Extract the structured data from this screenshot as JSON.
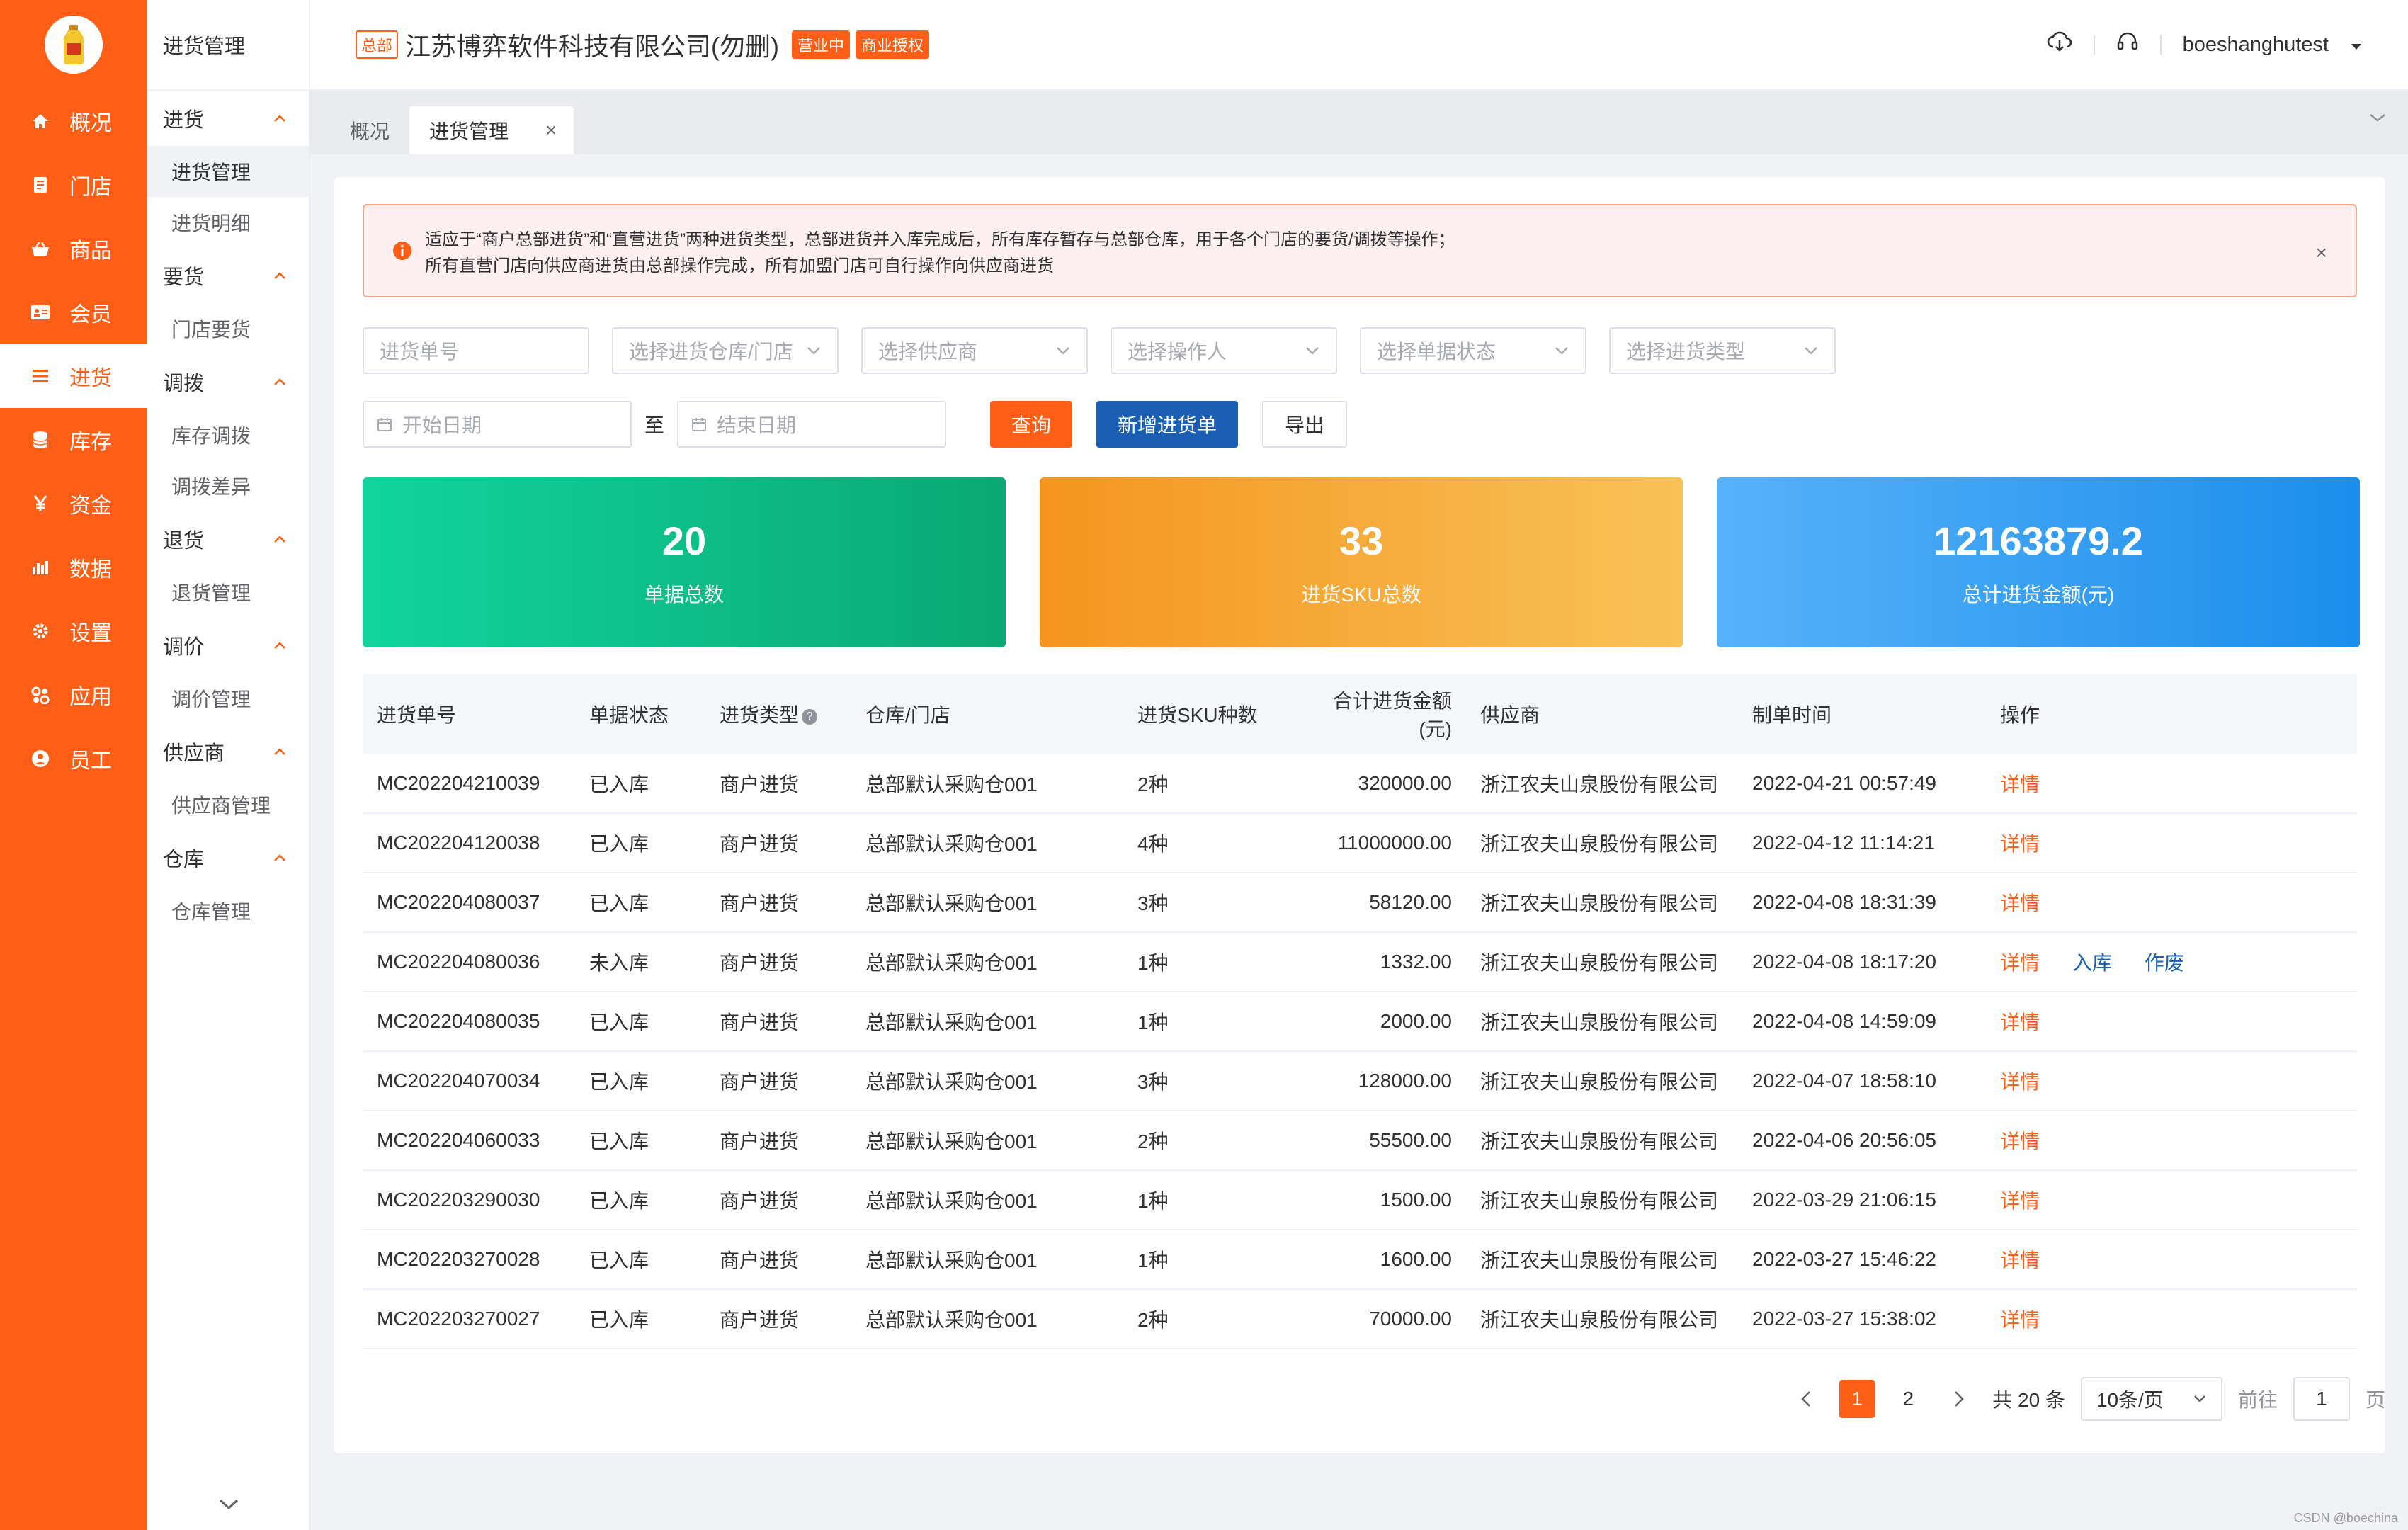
{
  "nav": [
    {
      "label": "概况",
      "icon": "home-icon"
    },
    {
      "label": "门店",
      "icon": "store-icon"
    },
    {
      "label": "商品",
      "icon": "goods-icon"
    },
    {
      "label": "会员",
      "icon": "member-card-icon"
    },
    {
      "label": "进货",
      "icon": "list-icon",
      "active": true
    },
    {
      "label": "库存",
      "icon": "database-icon"
    },
    {
      "label": "资金",
      "icon": "yen-icon"
    },
    {
      "label": "数据",
      "icon": "bar-chart-icon"
    },
    {
      "label": "设置",
      "icon": "gear-icon"
    },
    {
      "label": "应用",
      "icon": "apps-icon"
    },
    {
      "label": "员工",
      "icon": "user-icon"
    }
  ],
  "subnav": {
    "title": "进货管理",
    "groups": [
      {
        "label": "进货",
        "items": [
          "进货管理",
          "进货明细"
        ]
      },
      {
        "label": "要货",
        "items": [
          "门店要货"
        ]
      },
      {
        "label": "调拨",
        "items": [
          "库存调拨",
          "调拨差异"
        ]
      },
      {
        "label": "退货",
        "items": [
          "退货管理"
        ]
      },
      {
        "label": "调价",
        "items": [
          "调价管理"
        ]
      },
      {
        "label": "供应商",
        "items": [
          "供应商管理"
        ]
      },
      {
        "label": "仓库",
        "items": [
          "仓库管理"
        ]
      }
    ]
  },
  "header": {
    "hq_tag": "总部",
    "company": "江苏博弈软件科技有限公司(勿删)",
    "status_tag": "营业中",
    "license_tag": "商业授权",
    "username": "boeshanghutest"
  },
  "tabs": {
    "overview": "概况",
    "current": "进货管理",
    "close": "×"
  },
  "alert": {
    "line1": "适应于“商户总部进货”和“直营进货”两种进货类型，总部进货并入库完成后，所有库存暂存与总部仓库，用于各个门店的要货/调拨等操作；",
    "line2": "所有直营门店向供应商进货由总部操作完成，所有加盟门店可自行操作向供应商进货",
    "close": "×"
  },
  "filters": {
    "order_no": "进货单号",
    "warehouse": "选择进货仓库/门店",
    "supplier": "选择供应商",
    "operator": "选择操作人",
    "status": "选择单据状态",
    "type": "选择进货类型",
    "start_date": "开始日期",
    "to": "至",
    "end_date": "结束日期"
  },
  "buttons": {
    "query": "查询",
    "new_order": "新增进货单",
    "export": "导出"
  },
  "stats": [
    {
      "value": "20",
      "label": "单据总数"
    },
    {
      "value": "33",
      "label": "进货SKU总数"
    },
    {
      "value": "12163879.2",
      "label": "总计进货金额(元)"
    }
  ],
  "table": {
    "columns": [
      "进货单号",
      "单据状态",
      "进货类型",
      "仓库/门店",
      "进货SKU种数",
      "合计进货金额(元)",
      "供应商",
      "制单时间",
      "操作"
    ],
    "rows": [
      {
        "no": "MC202204210039",
        "status": "已入库",
        "type": "商户进货",
        "warehouse": "总部默认采购仓001",
        "sku": "2种",
        "amount": "320000.00",
        "supplier": "浙江农夫山泉股份有限公司",
        "time": "2022-04-21 00:57:49",
        "ops": [
          "详情"
        ]
      },
      {
        "no": "MC202204120038",
        "status": "已入库",
        "type": "商户进货",
        "warehouse": "总部默认采购仓001",
        "sku": "4种",
        "amount": "11000000.00",
        "supplier": "浙江农夫山泉股份有限公司",
        "time": "2022-04-12 11:14:21",
        "ops": [
          "详情"
        ]
      },
      {
        "no": "MC202204080037",
        "status": "已入库",
        "type": "商户进货",
        "warehouse": "总部默认采购仓001",
        "sku": "3种",
        "amount": "58120.00",
        "supplier": "浙江农夫山泉股份有限公司",
        "time": "2022-04-08 18:31:39",
        "ops": [
          "详情"
        ]
      },
      {
        "no": "MC202204080036",
        "status": "未入库",
        "type": "商户进货",
        "warehouse": "总部默认采购仓001",
        "sku": "1种",
        "amount": "1332.00",
        "supplier": "浙江农夫山泉股份有限公司",
        "time": "2022-04-08 18:17:20",
        "ops": [
          "详情",
          "入库",
          "作废"
        ]
      },
      {
        "no": "MC202204080035",
        "status": "已入库",
        "type": "商户进货",
        "warehouse": "总部默认采购仓001",
        "sku": "1种",
        "amount": "2000.00",
        "supplier": "浙江农夫山泉股份有限公司",
        "time": "2022-04-08 14:59:09",
        "ops": [
          "详情"
        ]
      },
      {
        "no": "MC202204070034",
        "status": "已入库",
        "type": "商户进货",
        "warehouse": "总部默认采购仓001",
        "sku": "3种",
        "amount": "128000.00",
        "supplier": "浙江农夫山泉股份有限公司",
        "time": "2022-04-07 18:58:10",
        "ops": [
          "详情"
        ]
      },
      {
        "no": "MC202204060033",
        "status": "已入库",
        "type": "商户进货",
        "warehouse": "总部默认采购仓001",
        "sku": "2种",
        "amount": "55500.00",
        "supplier": "浙江农夫山泉股份有限公司",
        "time": "2022-04-06 20:56:05",
        "ops": [
          "详情"
        ]
      },
      {
        "no": "MC202203290030",
        "status": "已入库",
        "type": "商户进货",
        "warehouse": "总部默认采购仓001",
        "sku": "1种",
        "amount": "1500.00",
        "supplier": "浙江农夫山泉股份有限公司",
        "time": "2022-03-29 21:06:15",
        "ops": [
          "详情"
        ]
      },
      {
        "no": "MC202203270028",
        "status": "已入库",
        "type": "商户进货",
        "warehouse": "总部默认采购仓001",
        "sku": "1种",
        "amount": "1600.00",
        "supplier": "浙江农夫山泉股份有限公司",
        "time": "2022-03-27 15:46:22",
        "ops": [
          "详情"
        ]
      },
      {
        "no": "MC202203270027",
        "status": "已入库",
        "type": "商户进货",
        "warehouse": "总部默认采购仓001",
        "sku": "2种",
        "amount": "70000.00",
        "supplier": "浙江农夫山泉股份有限公司",
        "time": "2022-03-27 15:38:02",
        "ops": [
          "详情"
        ]
      }
    ]
  },
  "pagination": {
    "pages": [
      "1",
      "2"
    ],
    "current": "1",
    "total": "共 20 条",
    "page_size": "10条/页",
    "goto_label": "前往",
    "goto_value": "1",
    "page_unit": "页"
  },
  "watermark": "CSDN @boechina",
  "colors": {
    "brand": "#ff5e16",
    "primary_blue": "#1a5fb4",
    "stat_green": "#0aa873",
    "stat_orange": "#f5951e",
    "stat_blue": "#1b8eeb"
  }
}
